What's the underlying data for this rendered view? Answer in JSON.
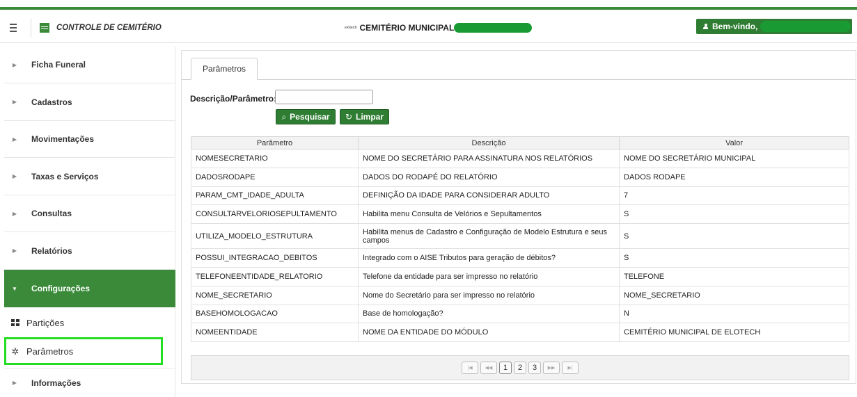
{
  "header": {
    "app_title": "CONTROLE DE CEMITÉRIO",
    "tiny_logo": "elotech",
    "center_title": "CEMITÉRIO MUNICIPAL",
    "welcome": "Bem-vindo,"
  },
  "sidebar": {
    "items": [
      {
        "label": "Ficha Funeral"
      },
      {
        "label": "Cadastros"
      },
      {
        "label": "Movimentações"
      },
      {
        "label": "Taxas e Serviços"
      },
      {
        "label": "Consultas"
      },
      {
        "label": "Relatórios"
      },
      {
        "label": "Configurações"
      },
      {
        "label": "Informações"
      }
    ],
    "subitems": [
      {
        "label": "Partições",
        "icon": "grid-icon"
      },
      {
        "label": "Parâmetros",
        "icon": "gear-icon"
      }
    ]
  },
  "main": {
    "tab": "Parâmetros",
    "search_label": "Descrição/Parâmetro:",
    "search_value": "",
    "btn_search": "Pesquisar",
    "btn_clear": "Limpar",
    "table": {
      "headers": [
        "Parâmetro",
        "Descrição",
        "Valor"
      ],
      "rows": [
        [
          "NOMESECRETARIO",
          "NOME DO SECRETÁRIO PARA ASSINATURA NOS RELATÓRIOS",
          "NOME DO SECRETÁRIO MUNICIPAL"
        ],
        [
          "DADOSRODAPE",
          "DADOS DO RODAPÉ DO RELATÓRIO",
          "DADOS RODAPE"
        ],
        [
          "PARAM_CMT_IDADE_ADULTA",
          "DEFINIÇÃO DA IDADE PARA CONSIDERAR ADULTO",
          "7"
        ],
        [
          "CONSULTARVELORIOSEPULTAMENTO",
          "Habilita menu Consulta de Velórios e Sepultamentos",
          "S"
        ],
        [
          "UTILIZA_MODELO_ESTRUTURA",
          "Habilita menus de Cadastro e Configuração de Modelo Estrutura e seus campos",
          "S"
        ],
        [
          "POSSUI_INTEGRACAO_DEBITOS",
          "Integrado com o AISE Tributos para geração de débitos?",
          "S"
        ],
        [
          "TELEFONEENTIDADE_RELATORIO",
          "Telefone da entidade para ser impresso no relatório",
          "TELEFONE"
        ],
        [
          "NOME_SECRETARIO",
          "Nome do Secretário para ser impresso no relatório",
          "NOME_SECRETARIO"
        ],
        [
          "BASEHOMOLOGACAO",
          "Base de homologação?",
          "N"
        ],
        [
          "NOMEENTIDADE",
          "NOME DA ENTIDADE DO MÓDULO",
          "CEMITÉRIO MUNICIPAL DE ELOTECH"
        ]
      ]
    },
    "pager": {
      "first": "|◀",
      "prev": "◀◀",
      "pages": [
        "1",
        "2",
        "3"
      ],
      "next": "▶▶",
      "last": "▶|"
    }
  }
}
